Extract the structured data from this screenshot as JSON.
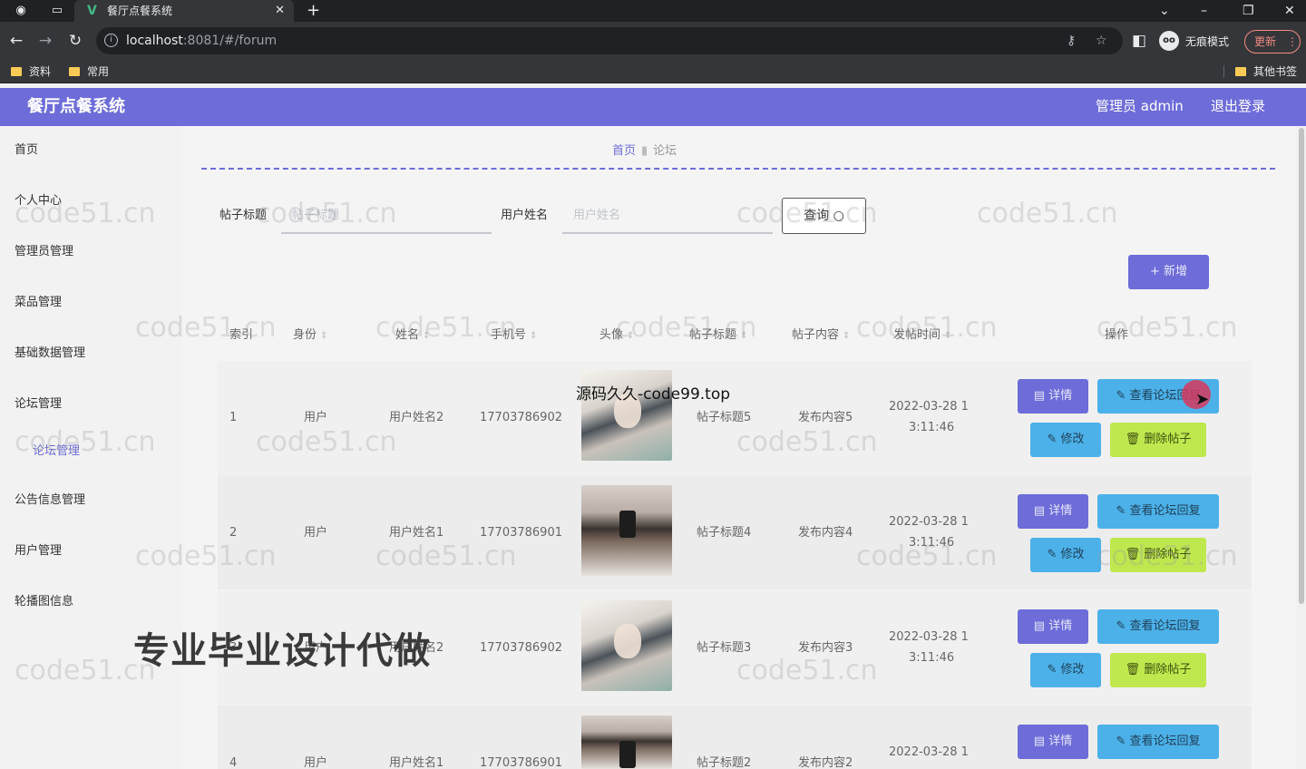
{
  "browser": {
    "tab_title": "餐厅点餐系统",
    "tab_icon": "vue-logo-icon",
    "url_host": "localhost",
    "url_path": ":8081/#/forum",
    "incognito_label": "无痕模式",
    "update_label": "更新",
    "bookmarks": [
      "资料",
      "常用"
    ],
    "other_bookmarks": "其他书签"
  },
  "header": {
    "title": "餐厅点餐系统",
    "user": "管理员 admin",
    "logout": "退出登录"
  },
  "sidebar": {
    "items": [
      "首页",
      "个人中心",
      "管理员管理",
      "菜品管理",
      "基础数据管理",
      "论坛管理",
      "公告信息管理",
      "用户管理",
      "轮播图信息"
    ],
    "sub_item": "论坛管理"
  },
  "breadcrumb": {
    "home": "首页",
    "current": "论坛"
  },
  "search": {
    "title_label": "帖子标题",
    "title_placeholder": "帖子标题",
    "name_label": "用户姓名",
    "name_placeholder": "用户姓名",
    "query_button": "查询"
  },
  "add_button": "新增",
  "table": {
    "headers": [
      "索引",
      "身份",
      "姓名",
      "手机号",
      "头像",
      "帖子标题",
      "帖子内容",
      "发帖时间",
      "操作"
    ],
    "rows": [
      {
        "index": "1",
        "role": "用户",
        "name": "用户姓名2",
        "phone": "17703786902",
        "avatar": "girl",
        "post_title": "帖子标题5",
        "post_content": "发布内容5",
        "time_line1": "2022-03-28 1",
        "time_line2": "3:11:46"
      },
      {
        "index": "2",
        "role": "用户",
        "name": "用户姓名1",
        "phone": "17703786901",
        "avatar": "boy",
        "post_title": "帖子标题4",
        "post_content": "发布内容4",
        "time_line1": "2022-03-28 1",
        "time_line2": "3:11:46"
      },
      {
        "index": "3",
        "role": "用户",
        "name": "用户姓名2",
        "phone": "17703786902",
        "avatar": "girl",
        "post_title": "帖子标题3",
        "post_content": "发布内容3",
        "time_line1": "2022-03-28 1",
        "time_line2": "3:11:46"
      },
      {
        "index": "4",
        "role": "用户",
        "name": "用户姓名1",
        "phone": "17703786901",
        "avatar": "boy",
        "post_title": "帖子标题2",
        "post_content": "发布内容2",
        "time_line1": "2022-03-28 1",
        "time_line2": ""
      }
    ],
    "actions": {
      "detail": "详情",
      "view_replies": "查看论坛回复",
      "edit": "修改",
      "delete": "删除帖子"
    }
  },
  "overlays": {
    "source_text": "源码久久-code99.top",
    "promo_text": "专业毕业设计代做",
    "watermark": "code51.cn"
  },
  "colors": {
    "accent": "#6d6cd9",
    "info": "#4cb1e8",
    "success": "#bfe84e"
  }
}
